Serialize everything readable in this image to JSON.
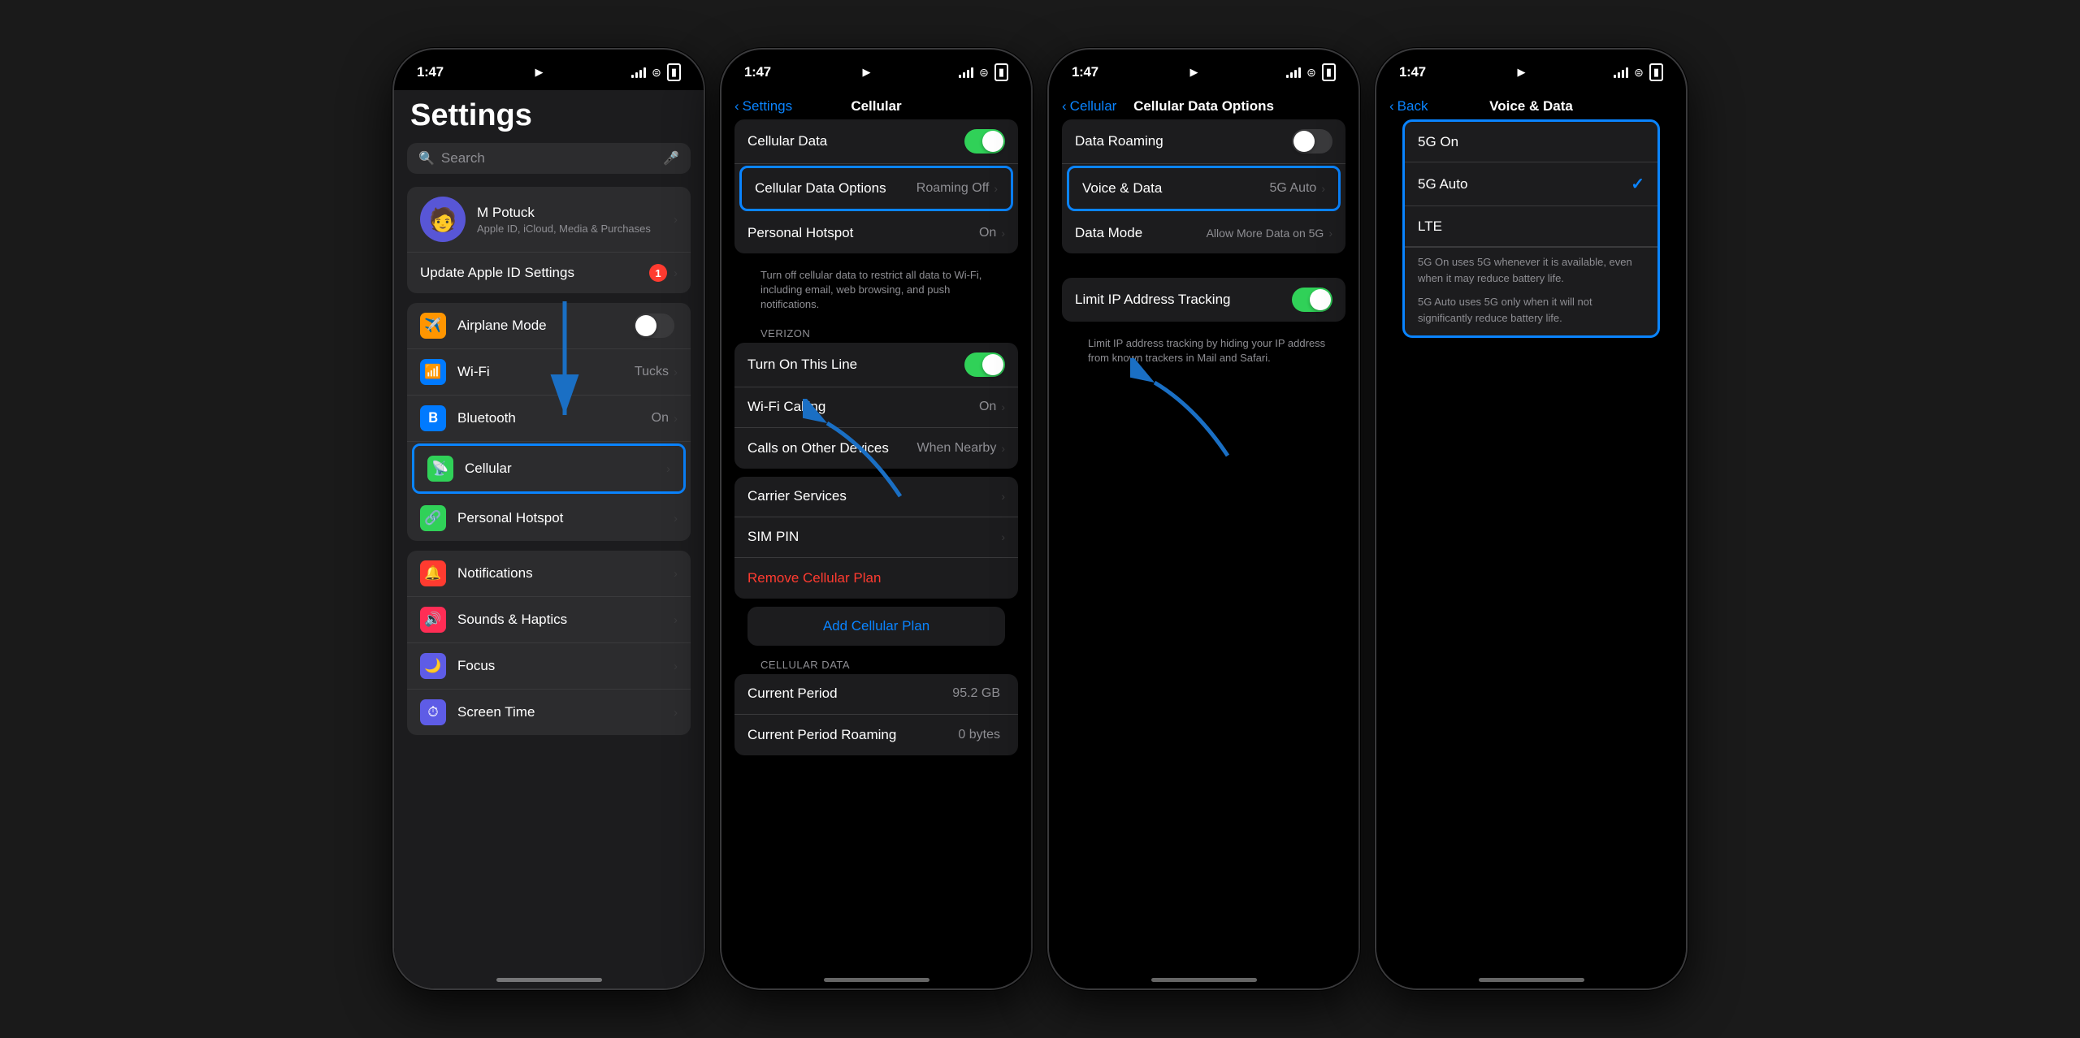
{
  "phones": [
    {
      "id": "phone1",
      "statusBar": {
        "time": "1:47",
        "hasLocation": true
      },
      "screen": {
        "type": "settings",
        "title": "Settings",
        "searchPlaceholder": "Search",
        "profile": {
          "name": "M Potuck",
          "subtitle": "Apple ID, iCloud, Media & Purchases"
        },
        "updateItem": {
          "label": "Update Apple ID Settings",
          "badge": "1"
        },
        "items": [
          {
            "icon": "✈️",
            "label": "Airplane Mode",
            "color": "#ff9500",
            "type": "toggle",
            "toggleState": "off"
          },
          {
            "icon": "📶",
            "label": "Wi-Fi",
            "value": "Tucks",
            "color": "#007aff",
            "type": "nav"
          },
          {
            "icon": "𝐁",
            "label": "Bluetooth",
            "value": "On",
            "color": "#007aff",
            "type": "nav"
          },
          {
            "icon": "📡",
            "label": "Cellular",
            "value": "",
            "color": "#30d158",
            "type": "nav",
            "highlighted": true
          },
          {
            "icon": "🔗",
            "label": "Personal Hotspot",
            "value": "",
            "color": "#30d158",
            "type": "nav"
          }
        ],
        "items2": [
          {
            "icon": "🔔",
            "label": "Notifications",
            "color": "#ff3b30",
            "type": "nav"
          },
          {
            "icon": "🔊",
            "label": "Sounds & Haptics",
            "color": "#ff2d55",
            "type": "nav"
          },
          {
            "icon": "🌙",
            "label": "Focus",
            "value": "",
            "color": "#5e5ce6",
            "type": "nav"
          },
          {
            "icon": "⏱",
            "label": "Screen Time",
            "value": "",
            "color": "#5e5ce6",
            "type": "nav"
          }
        ]
      }
    },
    {
      "id": "phone2",
      "statusBar": {
        "time": "1:47",
        "hasLocation": true
      },
      "screen": {
        "type": "cellular",
        "navBack": "Settings",
        "navTitle": "Cellular",
        "mainItems": [
          {
            "label": "Cellular Data",
            "type": "toggle",
            "toggleState": "on"
          },
          {
            "label": "Cellular Data Options",
            "value": "Roaming Off",
            "type": "nav",
            "highlighted": true
          },
          {
            "label": "Personal Hotspot",
            "value": "On",
            "type": "nav"
          }
        ],
        "mainDescription": "Turn off cellular data to restrict all data to Wi-Fi, including email, web browsing, and push notifications.",
        "sectionHeader": "VERIZON",
        "verizonItems": [
          {
            "label": "Turn On This Line",
            "type": "toggle",
            "toggleState": "on"
          },
          {
            "label": "Wi-Fi Calling",
            "value": "On",
            "type": "nav"
          },
          {
            "label": "Calls on Other Devices",
            "value": "When Nearby",
            "type": "nav"
          }
        ],
        "carrierItems": [
          {
            "label": "Carrier Services",
            "type": "nav"
          },
          {
            "label": "SIM PIN",
            "type": "nav"
          },
          {
            "label": "Remove Cellular Plan",
            "type": "red"
          }
        ],
        "addPlan": "Add Cellular Plan",
        "cellularDataHeader": "CELLULAR DATA",
        "usageItems": [
          {
            "label": "Current Period",
            "value": "95.2 GB"
          },
          {
            "label": "Current Period Roaming",
            "value": "0 bytes"
          }
        ]
      }
    },
    {
      "id": "phone3",
      "statusBar": {
        "time": "1:47",
        "hasLocation": true
      },
      "screen": {
        "type": "cellular-data-options",
        "navBack": "Cellular",
        "navTitle": "Cellular Data Options",
        "items": [
          {
            "label": "Data Roaming",
            "type": "toggle",
            "toggleState": "off"
          },
          {
            "label": "Voice & Data",
            "value": "5G Auto",
            "type": "nav",
            "highlighted": true
          },
          {
            "label": "Data Mode",
            "value": "Allow More Data on 5G",
            "type": "nav"
          }
        ],
        "trackingSection": {
          "label": "Limit IP Address Tracking",
          "type": "toggle",
          "toggleState": "on",
          "description": "Limit IP address tracking by hiding your IP address from known trackers in Mail and Safari."
        }
      }
    },
    {
      "id": "phone4",
      "statusBar": {
        "time": "1:47",
        "hasLocation": true
      },
      "screen": {
        "type": "voice-data",
        "navBack": "Back",
        "navTitle": "Voice & Data",
        "options": [
          {
            "label": "5G On",
            "selected": false
          },
          {
            "label": "5G Auto",
            "selected": true
          },
          {
            "label": "LTE",
            "selected": false
          }
        ],
        "infoTexts": [
          "5G On uses 5G whenever it is available, even when it may reduce battery life.",
          "5G Auto uses 5G only when it will not significantly reduce battery life."
        ]
      }
    }
  ]
}
